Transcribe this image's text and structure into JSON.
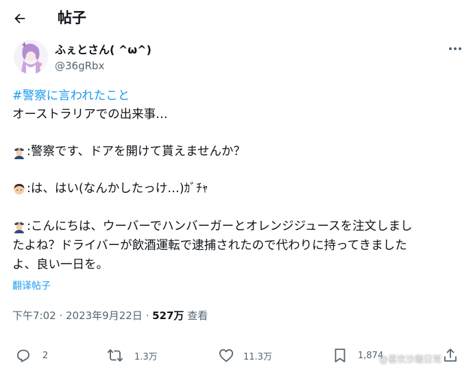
{
  "header": {
    "title": "帖子",
    "back_icon": "arrow-left-icon"
  },
  "author": {
    "display_name": "ふぇとさん( ^ω^)",
    "handle": "@36gRbx",
    "more_icon": "more-horizontal-icon"
  },
  "post": {
    "hashtag": "#警察に言われたこと",
    "line1": "オーストラリアでの出来事…",
    "line2": ":警察です、ドアを開けて貰えませんか？",
    "line3": ":は、はい(なんかしたっけ…)ｶﾞﾁｬ",
    "line4a": ":こんにちは、ウーバーでハンバーガーとオレンジジュースを注文しまし",
    "line4b": "たよね？ドライバーが飲酒運転で逮捕されたので代わりに持ってきました",
    "line4c": "よ、良い一日を。",
    "emoji_police": "police-officer-emoji",
    "emoji_person": "person-emoji"
  },
  "translate_label": "翻译帖子",
  "meta": {
    "time": "下午7:02",
    "sep1": " · ",
    "date": "2023年9月22日",
    "sep2": " · ",
    "views": "527万",
    "views_label": " 查看"
  },
  "actions": {
    "reply_count": "2",
    "repost_count": "1.3万",
    "like_count": "11.3万",
    "bookmark_count": "1,874"
  },
  "watermark": "@喜欢沙雕日常",
  "colors": {
    "link": "#1d9bf0",
    "secondary": "#536471",
    "text": "#0f1419"
  }
}
